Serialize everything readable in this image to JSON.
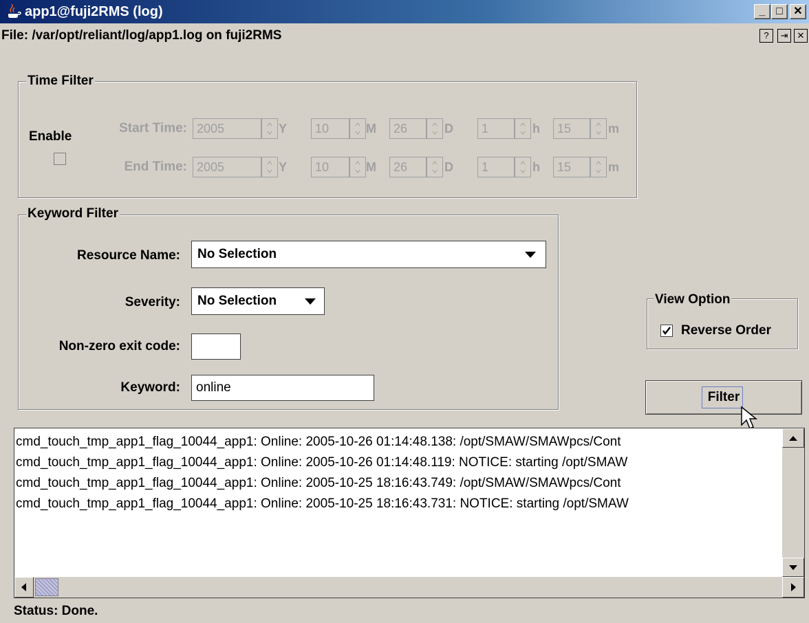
{
  "window": {
    "title": "app1@fuji2RMS (log)",
    "controls": {
      "minimize": "_",
      "maximize": "□",
      "close": "✕"
    }
  },
  "file_label": "File: /var/opt/reliant/log/app1.log on fuji2RMS",
  "header_buttons": {
    "help": "?",
    "detach": "⇥",
    "close": "✕"
  },
  "time_filter": {
    "title": "Time Filter",
    "enable_label": "Enable",
    "enabled": false,
    "start_label": "Start Time:",
    "end_label": "End Time:",
    "start": {
      "year": "2005",
      "month": "10",
      "day": "26",
      "hour": "1",
      "minute": "15"
    },
    "end": {
      "year": "2005",
      "month": "10",
      "day": "26",
      "hour": "1",
      "minute": "15"
    },
    "units": {
      "year": "Y",
      "month": "M",
      "day": "D",
      "hour": "h",
      "minute": "m"
    }
  },
  "keyword_filter": {
    "title": "Keyword Filter",
    "resource_label": "Resource Name:",
    "resource_value": "No Selection",
    "severity_label": "Severity:",
    "severity_value": "No Selection",
    "exit_code_label": "Non-zero exit code:",
    "exit_code_value": "",
    "keyword_label": "Keyword:",
    "keyword_value": "online"
  },
  "view_option": {
    "title": "View Option",
    "reverse_label": "Reverse Order",
    "reverse_checked": true
  },
  "filter_button": "Filter",
  "log_lines": [
    "cmd_touch_tmp_app1_flag_10044_app1: Online: 2005-10-26 01:14:48.138: /opt/SMAW/SMAWpcs/Cont",
    "cmd_touch_tmp_app1_flag_10044_app1: Online: 2005-10-26 01:14:48.119: NOTICE: starting /opt/SMAW",
    "cmd_touch_tmp_app1_flag_10044_app1: Online: 2005-10-25 18:16:43.749: /opt/SMAW/SMAWpcs/Cont",
    "cmd_touch_tmp_app1_flag_10044_app1: Online: 2005-10-25 18:16:43.731: NOTICE: starting /opt/SMAW"
  ],
  "status": "Status: Done.",
  "colors": {
    "window_bg": "#d4d0c8",
    "titlebar_start": "#0a246a",
    "titlebar_end": "#a6caf0"
  }
}
